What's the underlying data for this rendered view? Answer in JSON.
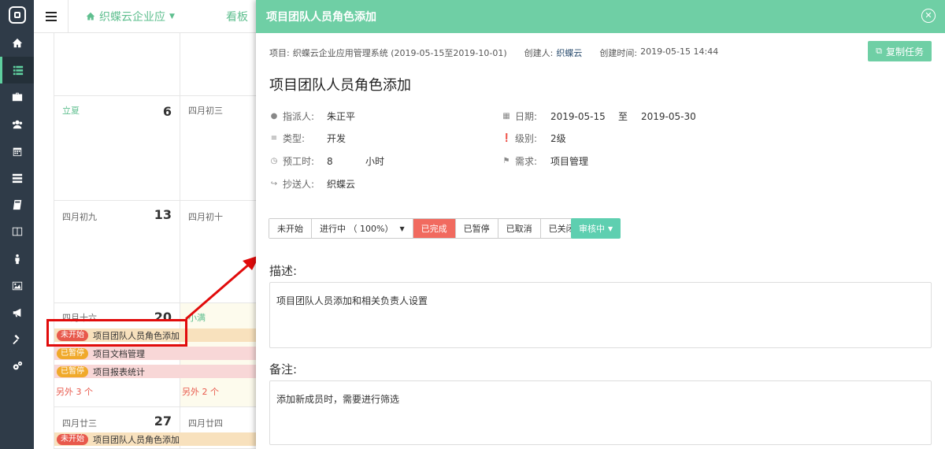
{
  "sidebar": {
    "items": [
      {
        "icon": "home-icon"
      },
      {
        "icon": "list-icon"
      },
      {
        "icon": "briefcase-icon"
      },
      {
        "icon": "users-icon"
      },
      {
        "icon": "calendar-icon"
      },
      {
        "icon": "server-icon"
      },
      {
        "icon": "book-icon"
      },
      {
        "icon": "columns-icon"
      },
      {
        "icon": "person-icon"
      },
      {
        "icon": "image-icon"
      },
      {
        "icon": "bullhorn-icon"
      },
      {
        "icon": "gavel-icon"
      },
      {
        "icon": "cogs-icon"
      }
    ]
  },
  "topbar": {
    "project": "织蝶云企业应",
    "kanban": "看板"
  },
  "calendar": {
    "cells": [
      {
        "lunar": "立夏",
        "day": "6"
      },
      {
        "lunar": "四月初三",
        "day": ""
      },
      {
        "lunar": "四月初九",
        "day": "13"
      },
      {
        "lunar": "四月初十",
        "day": ""
      },
      {
        "lunar": "四月十六",
        "day": "20"
      },
      {
        "lunar": "小满",
        "day": ""
      },
      {
        "lunar": "四月廿三",
        "day": "27"
      },
      {
        "lunar": "四月廿四",
        "day": ""
      }
    ],
    "events": [
      {
        "badge": "未开始",
        "title": "项目团队人员角色添加"
      },
      {
        "badge": "已暂停",
        "title": "项目文档管理"
      },
      {
        "badge": "已暂停",
        "title": "项目报表统计"
      },
      {
        "badge": "未开始",
        "title": "项目团队人员角色添加"
      }
    ],
    "more": [
      "另外 3 个",
      "另外 2 个"
    ]
  },
  "modal": {
    "header_title": "项目团队人员角色添加",
    "meta": {
      "project_label": "项目:",
      "project_value": "织蝶云企业应用管理系统 (2019-05-15至2019-10-01)",
      "creator_label": "创建人:",
      "creator_value": "织蝶云",
      "created_label": "创建时间:",
      "created_value": "2019-05-15 14:44"
    },
    "copy_button": "复制任务",
    "title": "项目团队人员角色添加",
    "fields": {
      "assignee_label": "指派人:",
      "assignee": "朱正平",
      "type_label": "类型:",
      "type": "开发",
      "hours_label": "预工时:",
      "hours": "8",
      "hours_unit": "小时",
      "cc_label": "抄送人:",
      "cc": "织蝶云",
      "date_label": "日期:",
      "date_start": "2019-05-15",
      "date_to": "至",
      "date_end": "2019-05-30",
      "level_label": "级别:",
      "level": "2级",
      "req_label": "需求:",
      "req": "项目管理"
    },
    "status_buttons": [
      "未开始",
      "进行中 （ 100%）",
      "已完成",
      "已暂停",
      "已取消",
      "已关闭"
    ],
    "status_active": "已完成",
    "review_button": "审核中",
    "desc_label": "描述:",
    "desc_text": "项目团队人员添加和相关负责人设置",
    "note_label": "备注:",
    "note_text": "添加新成员时，需要进行筛选"
  },
  "colors": {
    "accent": "#6fcfa5",
    "sidebar": "#2f3b48",
    "danger": "#e8594c",
    "warning": "#f0a92b"
  }
}
